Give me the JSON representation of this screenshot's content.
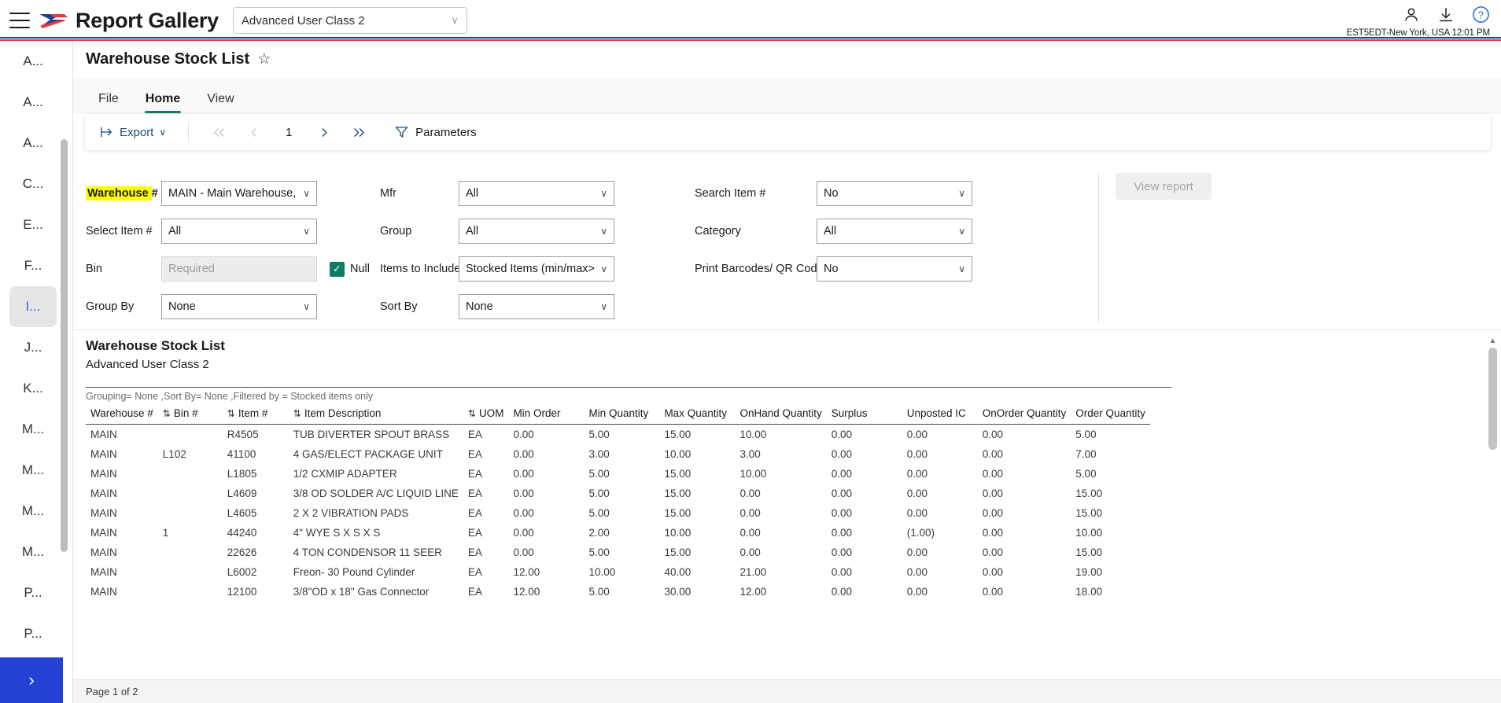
{
  "topbar": {
    "menu_icon": "hamburger-icon",
    "brand": "Report Gallery",
    "logo_icon": "arrow-logo-icon",
    "class_selector": {
      "value": "Advanced User Class 2",
      "chevron": "∨"
    },
    "account_icon": "person-icon",
    "download_icon": "download-icon",
    "help_icon": "question-help-icon",
    "timestamp": "EST5EDT-New York, USA 12:01 PM"
  },
  "sidebar": {
    "items": [
      {
        "label": "A...",
        "active": false
      },
      {
        "label": "A...",
        "active": false
      },
      {
        "label": "A...",
        "active": false
      },
      {
        "label": "C...",
        "active": false
      },
      {
        "label": "E...",
        "active": false
      },
      {
        "label": "F...",
        "active": false
      },
      {
        "label": "I...",
        "active": true
      },
      {
        "label": "J...",
        "active": false
      },
      {
        "label": "K...",
        "active": false
      },
      {
        "label": "M...",
        "active": false
      },
      {
        "label": "M...",
        "active": false
      },
      {
        "label": "M...",
        "active": false
      },
      {
        "label": "M...",
        "active": false
      },
      {
        "label": "P...",
        "active": false
      },
      {
        "label": "P...",
        "active": false
      }
    ],
    "expand_label": "›"
  },
  "page": {
    "title": "Warehouse Stock List",
    "favorite_icon": "☆"
  },
  "ribbon": {
    "tabs": [
      {
        "label": "File",
        "active": false
      },
      {
        "label": "Home",
        "active": true
      },
      {
        "label": "View",
        "active": false
      }
    ]
  },
  "toolbar": {
    "export_label": "Export",
    "export_chevron": "∨",
    "first_page_icon": "double-chevron-left-icon",
    "prev_page_icon": "chevron-left-icon",
    "page_number": "1",
    "next_page_icon": "chevron-right-icon",
    "last_page_icon": "double-chevron-right-icon",
    "parameters_label": "Parameters",
    "filter_icon": "funnel-icon"
  },
  "parameters": {
    "warehouse": {
      "label": "Warehouse #",
      "value": "MAIN - Main Warehouse, ",
      "highlighted": true
    },
    "select_item": {
      "label": "Select Item #",
      "value": "All"
    },
    "bin": {
      "label": "Bin",
      "placeholder": "Required",
      "value": ""
    },
    "null_checkbox": {
      "label": "Null",
      "checked": true,
      "mark": "✓"
    },
    "group_by": {
      "label": "Group By",
      "value": "None"
    },
    "mfr": {
      "label": "Mfr",
      "value": "All"
    },
    "group": {
      "label": "Group",
      "value": "All"
    },
    "items_to_include": {
      "label": "Items to Include",
      "value": "Stocked Items (min/max>("
    },
    "sort_by": {
      "label": "Sort By",
      "value": "None"
    },
    "search_item": {
      "label": "Search Item #",
      "value": "No"
    },
    "category": {
      "label": "Category",
      "value": "All"
    },
    "print_barcodes": {
      "label": "Print Barcodes/ QR Codes",
      "value": "No"
    },
    "view_report_label": "View report",
    "chevron": "∨"
  },
  "report": {
    "title": "Warehouse Stock List",
    "subtitle": "Advanced User Class 2",
    "meta": "Grouping= None ,Sort By= None ,Filtered by =  Stocked items only",
    "sort_icon": "⇅",
    "columns": [
      {
        "label": "Warehouse #",
        "sortable": true
      },
      {
        "label": "Bin #",
        "sortable": true
      },
      {
        "label": "Item #",
        "sortable": true
      },
      {
        "label": "Item Description",
        "sortable": true
      },
      {
        "label": "UOM",
        "sortable": false
      },
      {
        "label": "Min Order",
        "sortable": false
      },
      {
        "label": "Min Quantity",
        "sortable": false
      },
      {
        "label": "Max Quantity",
        "sortable": false
      },
      {
        "label": "OnHand Quantity",
        "sortable": false
      },
      {
        "label": "Surplus",
        "sortable": false
      },
      {
        "label": "Unposted IC",
        "sortable": false
      },
      {
        "label": "OnOrder Quantity",
        "sortable": false
      },
      {
        "label": "Order Quantity",
        "sortable": false
      }
    ],
    "rows": [
      [
        "MAIN",
        "",
        "R4505",
        "TUB DIVERTER SPOUT BRASS",
        "EA",
        "0.00",
        "5.00",
        "15.00",
        "10.00",
        "0.00",
        "0.00",
        "0.00",
        "5.00"
      ],
      [
        "MAIN",
        "L102",
        "41100",
        "4 GAS/ELECT PACKAGE UNIT",
        "EA",
        "0.00",
        "3.00",
        "10.00",
        "3.00",
        "0.00",
        "0.00",
        "0.00",
        "7.00"
      ],
      [
        "MAIN",
        "",
        "L1805",
        "1/2 CXMIP ADAPTER",
        "EA",
        "0.00",
        "5.00",
        "15.00",
        "10.00",
        "0.00",
        "0.00",
        "0.00",
        "5.00"
      ],
      [
        "MAIN",
        "",
        "L4609",
        "3/8 OD SOLDER A/C LIQUID LINE",
        "EA",
        "0.00",
        "5.00",
        "15.00",
        "0.00",
        "0.00",
        "0.00",
        "0.00",
        "15.00"
      ],
      [
        "MAIN",
        "",
        "L4605",
        "2 X 2 VIBRATION PADS",
        "EA",
        "0.00",
        "5.00",
        "15.00",
        "0.00",
        "0.00",
        "0.00",
        "0.00",
        "15.00"
      ],
      [
        "MAIN",
        "1",
        "44240",
        "4\" WYE  S X S X S",
        "EA",
        "0.00",
        "2.00",
        "10.00",
        "0.00",
        "0.00",
        "(1.00)",
        "0.00",
        "10.00"
      ],
      [
        "MAIN",
        "",
        "22626",
        "4 TON CONDENSOR 11 SEER",
        "EA",
        "0.00",
        "5.00",
        "15.00",
        "0.00",
        "0.00",
        "0.00",
        "0.00",
        "15.00"
      ],
      [
        "MAIN",
        "",
        "L6002",
        "Freon- 30 Pound Cylinder",
        "EA",
        "12.00",
        "10.00",
        "40.00",
        "21.00",
        "0.00",
        "0.00",
        "0.00",
        "19.00"
      ],
      [
        "MAIN",
        "",
        "12100",
        "3/8\"OD x 18\" Gas Connector",
        "EA",
        "12.00",
        "5.00",
        "30.00",
        "12.00",
        "0.00",
        "0.00",
        "0.00",
        "18.00"
      ]
    ],
    "scroll_up_icon": "▲",
    "scroll_down_icon": "▼"
  },
  "statusbar": {
    "text": "Page 1 of 2"
  }
}
